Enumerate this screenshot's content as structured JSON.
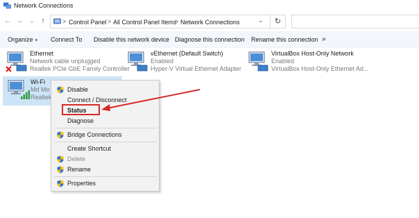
{
  "window": {
    "title": "Network Connections"
  },
  "address": {
    "crumbs": [
      "Control Panel",
      "All Control Panel Items",
      "Network Connections"
    ],
    "separator": ">",
    "dropdown_glyph": "⌄",
    "refresh_glyph": "↻",
    "nav": {
      "back": "←",
      "forward": "→",
      "history": "⌄",
      "up": "↑"
    }
  },
  "toolbar": {
    "organize": "Organize",
    "organize_caret": "▾",
    "connect_to": "Connect To",
    "disable_device": "Disable this network device",
    "diagnose": "Diagnose this connection",
    "rename": "Rename this connection",
    "more": "»"
  },
  "adapters": [
    {
      "name": "Ethernet",
      "status": "Network cable unplugged",
      "device": "Realtek PCIe GbE Family Controller",
      "icon": "ethernet-disconnected-icon"
    },
    {
      "name": "vEthernet (Default Switch)",
      "status": "Enabled",
      "device": "Hyper-V Virtual Ethernet Adapter",
      "icon": "ethernet-icon"
    },
    {
      "name": "VirtualBox Host-Only Network",
      "status": "Enabled",
      "device": "VirtualBox Host-Only Ethernet Ad...",
      "icon": "ethernet-icon"
    },
    {
      "name": "Wi-Fi",
      "status": "Md Mo",
      "device": "Realtek",
      "icon": "wifi-icon",
      "selected": true
    }
  ],
  "context_menu": {
    "items": [
      {
        "label": "Disable",
        "shield": true
      },
      {
        "label": "Connect / Disconnect",
        "shield": false
      },
      {
        "label": "Status",
        "shield": false,
        "bold": true
      },
      {
        "label": "Diagnose",
        "shield": false
      },
      {
        "label": "Bridge Connections",
        "shield": true
      },
      {
        "label": "Create Shortcut",
        "shield": false
      },
      {
        "label": "Delete",
        "shield": true,
        "disabled": true
      },
      {
        "label": "Rename",
        "shield": true
      },
      {
        "label": "Properties",
        "shield": true
      }
    ]
  },
  "colors": {
    "selection": "#cce4f7",
    "toolbar_bg": "#f3f6fb",
    "annotation_red": "#d42a2a",
    "menu_bg": "#f2f2f2"
  }
}
